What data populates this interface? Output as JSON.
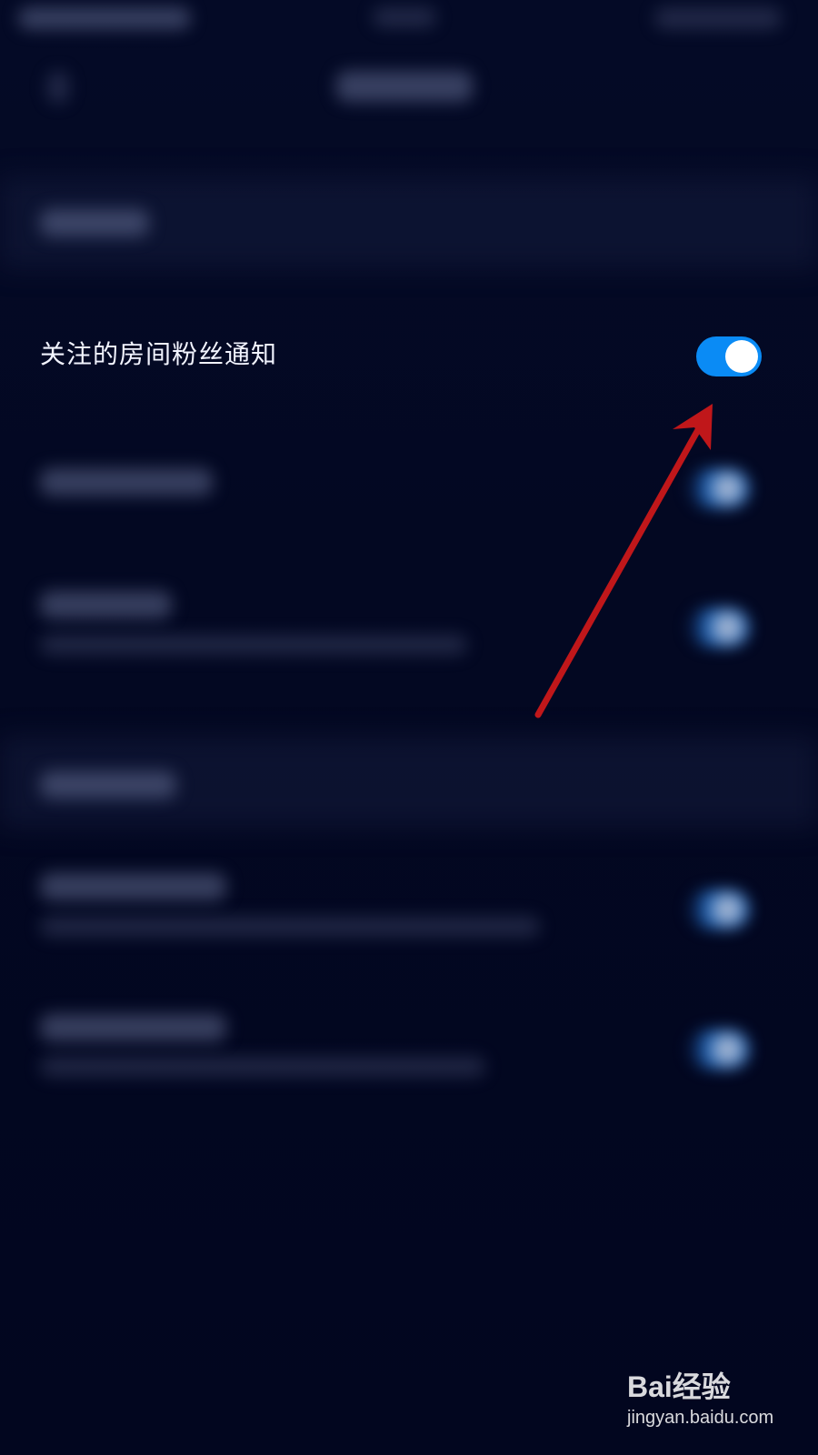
{
  "settings": {
    "focused_item": {
      "label": "关注的房间粉丝通知",
      "toggle_on": true
    }
  },
  "colors": {
    "background": "#02061f",
    "toggle_on": "#0a8bf5",
    "annotation_arrow": "#c0171a"
  },
  "watermark": {
    "brand": "Bai经验",
    "url": "jingyan.baidu.com"
  }
}
